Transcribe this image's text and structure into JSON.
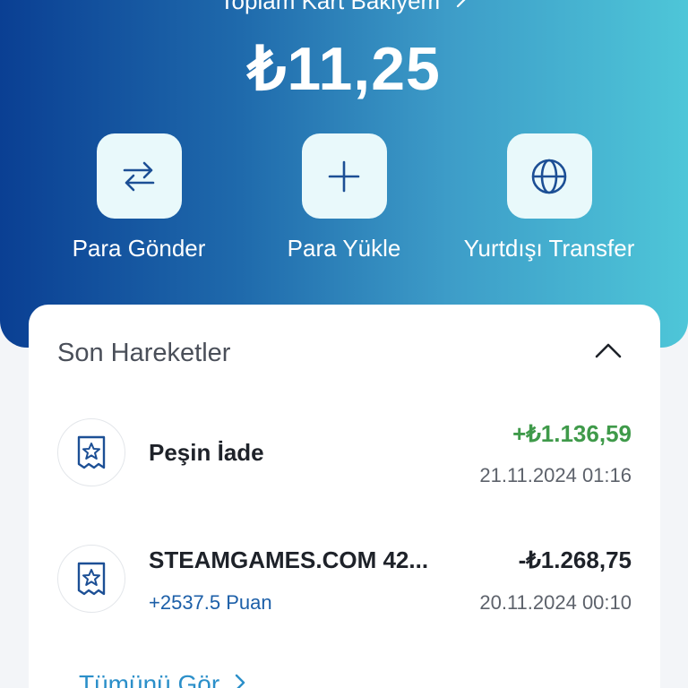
{
  "header": {
    "balance_label": "Toplam Kart Bakiyem",
    "balance": "₺11,25"
  },
  "actions": [
    {
      "label": "Para Gönder",
      "icon": "swap-arrows-icon"
    },
    {
      "label": "Para Yükle",
      "icon": "plus-icon"
    },
    {
      "label": "Yurtdışı Transfer",
      "icon": "globe-icon"
    }
  ],
  "recent": {
    "title": "Son Hareketler",
    "items": [
      {
        "name": "Peşin İade",
        "amount": "+₺1.136,59",
        "date": "21.11.2024 01:16",
        "points": ""
      },
      {
        "name": "STEAMGAMES.COM 42...",
        "amount": "-₺1.268,75",
        "date": "20.11.2024 00:10",
        "points": "+2537.5 Puan"
      }
    ],
    "see_all": "Tümünü Gör"
  },
  "colors": {
    "gradient_start": "#0a3f93",
    "gradient_end": "#4ec6d8",
    "positive": "#3f9a4a",
    "icon": "#1c4f95",
    "link": "#2b8fc9"
  }
}
